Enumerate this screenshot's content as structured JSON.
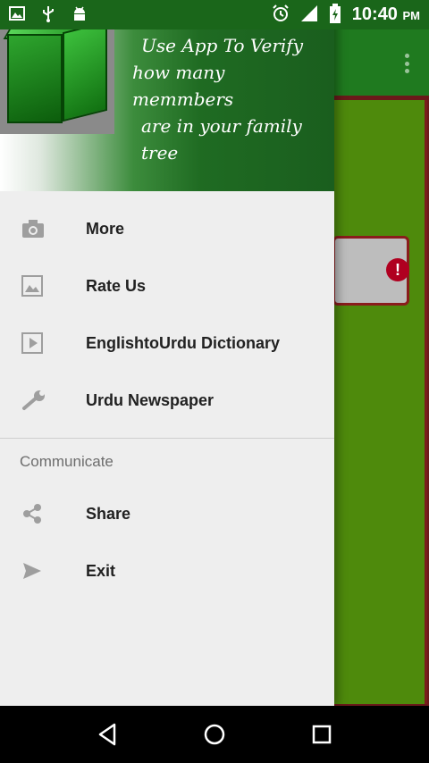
{
  "status_bar": {
    "time": "10:40",
    "time_suffix": "PM",
    "left_icons": [
      "image-icon",
      "usb-icon",
      "android-icon"
    ],
    "right_icons": [
      "alarm-icon",
      "signal-icon",
      "battery-charging-icon"
    ]
  },
  "app": {
    "toolbar_icons": [
      "overflow-menu-icon"
    ],
    "alert_icon_glyph": "!"
  },
  "drawer": {
    "header": {
      "tagline_lines": [
        "Use App To Verify",
        "how many memmbers",
        "are in your family tree"
      ]
    },
    "menu_items": [
      {
        "label": "More",
        "icon": "camera-icon"
      },
      {
        "label": "Rate Us",
        "icon": "image-icon"
      },
      {
        "label": "EnglishtoUrdu Dictionary",
        "icon": "play-icon"
      },
      {
        "label": "Urdu Newspaper",
        "icon": "wrench-icon"
      }
    ],
    "section_header": "Communicate",
    "communicate_items": [
      {
        "label": "Share",
        "icon": "share-icon"
      },
      {
        "label": "Exit",
        "icon": "send-icon"
      }
    ]
  },
  "nav_bar": {
    "buttons": [
      "back-icon",
      "home-icon",
      "recents-icon"
    ]
  },
  "colors": {
    "drawer_background": "#eeeeee",
    "header_green": "#1f6b22",
    "app_green": "#4e8a0c",
    "menu_icon_gray": "#9e9e9e",
    "alert_red": "#b00020"
  }
}
